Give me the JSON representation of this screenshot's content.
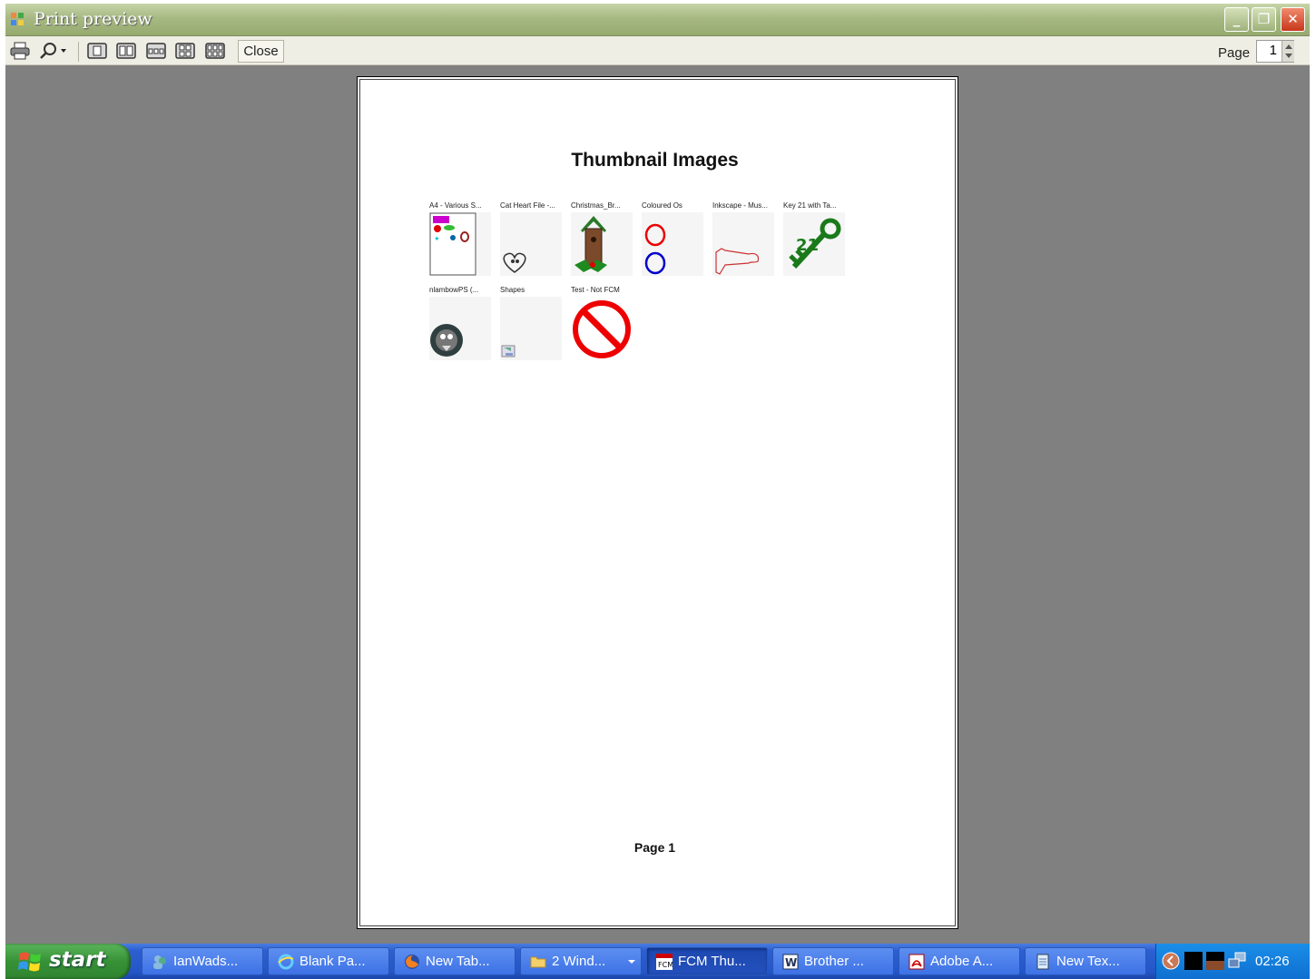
{
  "window": {
    "title": "Print preview",
    "controls": {
      "minimize": "_",
      "restore": "❐",
      "close": "✕"
    }
  },
  "toolbar": {
    "close_label": "Close",
    "page_label": "Page",
    "page_value": "1"
  },
  "document": {
    "title": "Thumbnail Images",
    "footer": "Page 1",
    "thumbnails": [
      {
        "caption": "A4 - Various S...",
        "icon": "shapes-sheet-icon"
      },
      {
        "caption": "Cat Heart File -...",
        "icon": "cat-heart-icon"
      },
      {
        "caption": "Christmas_Br...",
        "icon": "christmas-birdhouse-icon"
      },
      {
        "caption": "Coloured Os",
        "icon": "coloured-os-icon"
      },
      {
        "caption": "Inkscape - Mus...",
        "icon": "horn-outline-icon"
      },
      {
        "caption": "Key 21 with Ta...",
        "icon": "green-key-icon"
      },
      {
        "caption": "nlambowPS (...",
        "icon": "owl-badge-icon"
      },
      {
        "caption": "Shapes",
        "icon": "small-shapes-icon"
      },
      {
        "caption": "Test - Not FCM",
        "icon": "no-entry-icon"
      }
    ]
  },
  "taskbar": {
    "start_label": "start",
    "tasks": [
      {
        "label": "IanWads...",
        "icon": "messenger-icon"
      },
      {
        "label": "Blank Pa...",
        "icon": "ie-icon"
      },
      {
        "label": "New Tab...",
        "icon": "firefox-icon"
      },
      {
        "label": "2 Wind...",
        "icon": "folder-icon"
      },
      {
        "label": "FCM Thu...",
        "icon": "fcm-app-icon"
      },
      {
        "label": "Brother ...",
        "icon": "word-icon"
      },
      {
        "label": "Adobe A...",
        "icon": "acrobat-icon"
      },
      {
        "label": "New Tex...",
        "icon": "notepad-icon"
      }
    ],
    "clock": "02:26"
  },
  "colors": {
    "titlebar": "#a7b983",
    "workspace": "#808080",
    "taskbar": "#2456c8",
    "start_button": "#379237"
  }
}
